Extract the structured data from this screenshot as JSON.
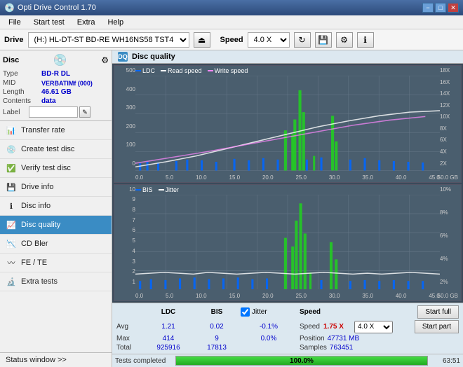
{
  "titlebar": {
    "title": "Opti Drive Control 1.70",
    "minimize": "−",
    "maximize": "□",
    "close": "✕"
  },
  "menubar": {
    "items": [
      "File",
      "Start test",
      "Extra",
      "Help"
    ]
  },
  "toolbar": {
    "drive_label": "Drive",
    "drive_value": "(H:)  HL-DT-ST BD-RE  WH16NS58 TST4",
    "speed_label": "Speed",
    "speed_value": "4.0 X"
  },
  "sidebar": {
    "disc_label": "Disc",
    "disc_fields": [
      {
        "label": "Type",
        "value": "BD-R DL"
      },
      {
        "label": "MID",
        "value": "VERBATIMf (000)"
      },
      {
        "label": "Length",
        "value": "46.61 GB"
      },
      {
        "label": "Contents",
        "value": "data"
      }
    ],
    "label_label": "Label",
    "nav_items": [
      {
        "label": "Transfer rate",
        "active": false,
        "icon": "chart"
      },
      {
        "label": "Create test disc",
        "active": false,
        "icon": "disc"
      },
      {
        "label": "Verify test disc",
        "active": false,
        "icon": "verify"
      },
      {
        "label": "Drive info",
        "active": false,
        "icon": "drive"
      },
      {
        "label": "Disc info",
        "active": false,
        "icon": "disc-info"
      },
      {
        "label": "Disc quality",
        "active": true,
        "icon": "quality"
      },
      {
        "label": "CD Bler",
        "active": false,
        "icon": "bler"
      },
      {
        "label": "FE / TE",
        "active": false,
        "icon": "fe"
      },
      {
        "label": "Extra tests",
        "active": false,
        "icon": "extra"
      }
    ],
    "status_window": "Status window >>"
  },
  "disc_quality": {
    "title": "Disc quality",
    "legend": [
      {
        "label": "LDC",
        "color": "#0066ff"
      },
      {
        "label": "Read speed",
        "color": "white"
      },
      {
        "label": "Write speed",
        "color": "#ff88ff"
      }
    ],
    "chart1": {
      "y_left": [
        "500",
        "400",
        "300",
        "200",
        "100",
        "0"
      ],
      "y_right": [
        "18X",
        "16X",
        "14X",
        "12X",
        "10X",
        "8X",
        "6X",
        "4X",
        "2X"
      ],
      "x_labels": [
        "0.0",
        "5.0",
        "10.0",
        "15.0",
        "20.0",
        "25.0",
        "30.0",
        "35.0",
        "40.0",
        "45.0",
        "50.0 GB"
      ]
    },
    "chart2": {
      "title_legend": [
        {
          "label": "BIS",
          "color": "#0066ff"
        },
        {
          "label": "Jitter",
          "color": "white"
        }
      ],
      "y_left": [
        "10",
        "9",
        "8",
        "7",
        "6",
        "5",
        "4",
        "3",
        "2",
        "1"
      ],
      "y_right": [
        "10%",
        "8%",
        "6%",
        "4%",
        "2%"
      ],
      "x_labels": [
        "0.0",
        "5.0",
        "10.0",
        "15.0",
        "20.0",
        "25.0",
        "30.0",
        "35.0",
        "40.0",
        "45.0",
        "50.0 GB"
      ]
    }
  },
  "stats": {
    "headers": [
      "LDC",
      "BIS",
      "",
      "Jitter",
      "Speed",
      ""
    ],
    "avg_label": "Avg",
    "avg_ldc": "1.21",
    "avg_bis": "0.02",
    "avg_jitter": "-0.1%",
    "max_label": "Max",
    "max_ldc": "414",
    "max_bis": "9",
    "max_jitter": "0.0%",
    "total_label": "Total",
    "total_ldc": "925916",
    "total_bis": "17813",
    "jitter_checked": true,
    "jitter_label": "Jitter",
    "speed_label": "Speed",
    "speed_val": "1.75 X",
    "speed_select": "4.0 X",
    "position_label": "Position",
    "position_val": "47731 MB",
    "samples_label": "Samples",
    "samples_val": "763451",
    "start_full_label": "Start full",
    "start_part_label": "Start part"
  },
  "bottom": {
    "status": "Tests completed",
    "progress": "100.0%",
    "progress_value": 100,
    "time": "63:51"
  }
}
